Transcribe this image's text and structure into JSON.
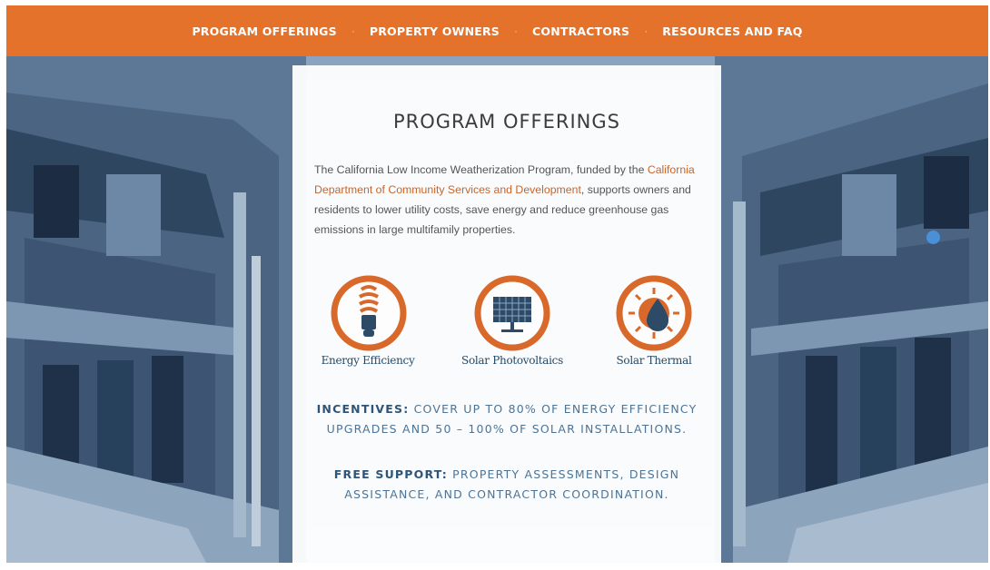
{
  "nav": {
    "items": [
      {
        "label": "PROGRAM OFFERINGS"
      },
      {
        "label": "PROPERTY OWNERS"
      },
      {
        "label": "CONTRACTORS"
      },
      {
        "label": "RESOURCES AND FAQ"
      }
    ],
    "separator": "·"
  },
  "card": {
    "title": "PROGRAM OFFERINGS",
    "desc_part1": "The California Low Income Weatherization Program, funded by the ",
    "desc_link": "California Department of Community Services and Development",
    "desc_part2": ", supports owners and residents to lower utility costs, save energy and reduce greenhouse gas emissions in large multifamily properties.",
    "offerings": [
      {
        "label": "Energy Efficiency",
        "icon": "light-bulb-icon"
      },
      {
        "label": "Solar Photovoltaics",
        "icon": "solar-panel-icon"
      },
      {
        "label": "Solar Thermal",
        "icon": "sun-water-drop-icon"
      }
    ],
    "incentives_label": "INCENTIVES:",
    "incentives_text": " COVER UP TO 80% OF ENERGY EFFICIENCY UPGRADES AND 50 – 100% OF SOLAR INSTALLATIONS.",
    "support_label": "FREE SUPPORT:",
    "support_text": " PROPERTY ASSESSMENTS, DESIGN ASSISTANCE, AND CONTRACTOR COORDINATION."
  },
  "colors": {
    "nav_bg": "#e5722a",
    "accent": "#c9642a",
    "icon_ring": "#d9692a",
    "heading_blue": "#2e5578",
    "slider_dot": "#4a90d6"
  }
}
